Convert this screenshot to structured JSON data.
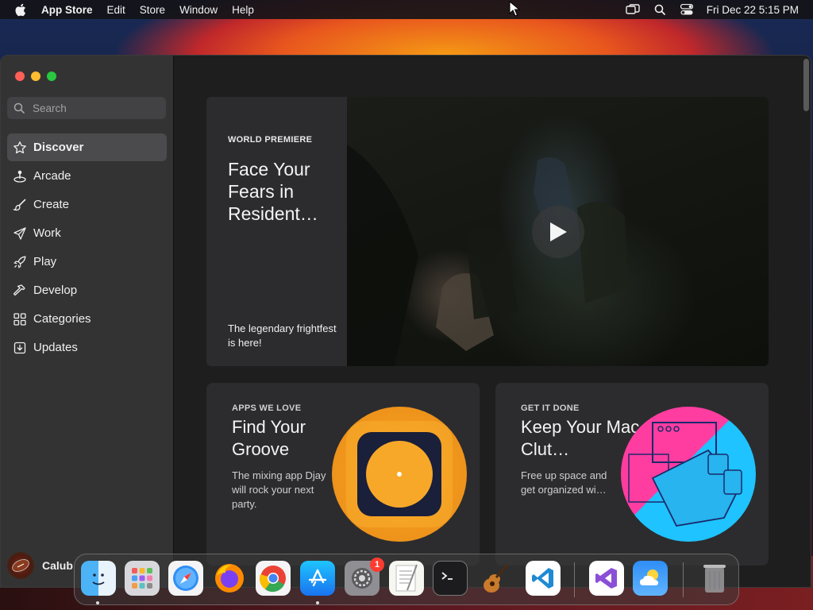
{
  "menubar": {
    "app_name": "App Store",
    "items": [
      "Edit",
      "Store",
      "Window",
      "Help"
    ],
    "datetime": "Fri Dec 22  5:15 PM"
  },
  "sidebar": {
    "search_placeholder": "Search",
    "items": [
      {
        "label": "Discover",
        "icon": "star-icon",
        "active": true
      },
      {
        "label": "Arcade",
        "icon": "joystick-icon"
      },
      {
        "label": "Create",
        "icon": "brush-icon"
      },
      {
        "label": "Work",
        "icon": "paperplane-icon"
      },
      {
        "label": "Play",
        "icon": "rocket-icon"
      },
      {
        "label": "Develop",
        "icon": "hammer-icon"
      },
      {
        "label": "Categories",
        "icon": "grid-icon"
      },
      {
        "label": "Updates",
        "icon": "download-icon"
      }
    ],
    "user_name": "Calub"
  },
  "hero": {
    "eyebrow": "WORLD PREMIERE",
    "title": "Face Your Fears in Resident…",
    "subtitle": "The legendary frightfest is here!"
  },
  "cards": [
    {
      "eyebrow": "APPS WE LOVE",
      "title": "Find Your Groove",
      "subtitle": "The mixing app Djay will rock your next party."
    },
    {
      "eyebrow": "GET IT DONE",
      "title": "Keep Your Mac Clut…",
      "subtitle": "Free up space and get organized wi…"
    }
  ],
  "dock": {
    "apps": [
      "Finder",
      "Launchpad",
      "Safari",
      "Firefox",
      "Chrome",
      "App Store",
      "System Settings",
      "TextEdit",
      "Terminal",
      "GarageBand",
      "Visual Studio Code",
      "Visual Studio",
      "Weather",
      "Trash"
    ],
    "settings_badge": "1"
  }
}
